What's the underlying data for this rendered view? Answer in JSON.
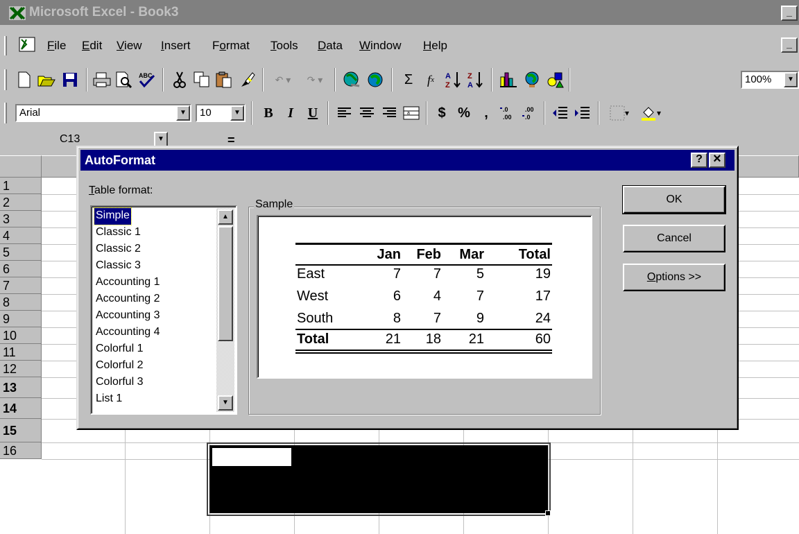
{
  "window": {
    "title": "Microsoft Excel - Book3",
    "minimize_glyph": "_"
  },
  "menubar": {
    "items": [
      "File",
      "Edit",
      "View",
      "Insert",
      "Format",
      "Tools",
      "Data",
      "Window",
      "Help"
    ],
    "mnemonics": [
      "F",
      "E",
      "V",
      "I",
      "o",
      "T",
      "D",
      "W",
      "H"
    ],
    "restore_glyph": "_"
  },
  "standard_toolbar": {
    "icons": [
      "new-icon",
      "open-icon",
      "save-icon",
      "print-icon",
      "print-preview-icon",
      "spelling-icon",
      "cut-icon",
      "copy-icon",
      "paste-icon",
      "format-painter-icon",
      "undo-icon",
      "redo-icon",
      "insert-hyperlink-icon",
      "web-toolbar-icon",
      "autosum-icon",
      "paste-function-icon",
      "sort-ascending-icon",
      "sort-descending-icon",
      "chart-wizard-icon",
      "map-icon",
      "drawing-icon"
    ],
    "zoom": "100%"
  },
  "formatting_toolbar": {
    "font_name": "Arial",
    "font_size": "10",
    "bold": "B",
    "italic": "I",
    "underline": "U",
    "currency": "$",
    "percent": "%",
    "comma": ","
  },
  "formula_bar": {
    "name_box": "C13",
    "equals": "="
  },
  "grid": {
    "row_numbers": [
      "1",
      "2",
      "3",
      "4",
      "5",
      "6",
      "7",
      "8",
      "9",
      "10",
      "11",
      "12",
      "13",
      "14",
      "15",
      "16"
    ],
    "selected_rows": [
      "13",
      "14",
      "15"
    ],
    "active_cell": "C13"
  },
  "dialog": {
    "title": "AutoFormat",
    "help_glyph": "?",
    "close_glyph": "×",
    "table_format_label": "Table format:",
    "table_format_mnemonic": "T",
    "formats": [
      "Simple",
      "Classic 1",
      "Classic 2",
      "Classic 3",
      "Accounting 1",
      "Accounting 2",
      "Accounting 3",
      "Accounting 4",
      "Colorful 1",
      "Colorful 2",
      "Colorful 3",
      "List 1"
    ],
    "selected_format": "Simple",
    "sample_label": "Sample",
    "ok_label": "OK",
    "cancel_label": "Cancel",
    "options_label": "Options >>",
    "options_mnemonic": "O",
    "sample": {
      "headers": [
        "",
        "Jan",
        "Feb",
        "Mar",
        "Total"
      ],
      "rows": [
        [
          "East",
          "7",
          "7",
          "5",
          "19"
        ],
        [
          "West",
          "6",
          "4",
          "7",
          "17"
        ],
        [
          "South",
          "8",
          "7",
          "9",
          "24"
        ]
      ],
      "total_row": [
        "Total",
        "21",
        "18",
        "21",
        "60"
      ]
    }
  },
  "colors": {
    "title_bar": "#808080",
    "dialog_title": "#000080",
    "face": "#c0c0c0",
    "selection": "#000000"
  }
}
